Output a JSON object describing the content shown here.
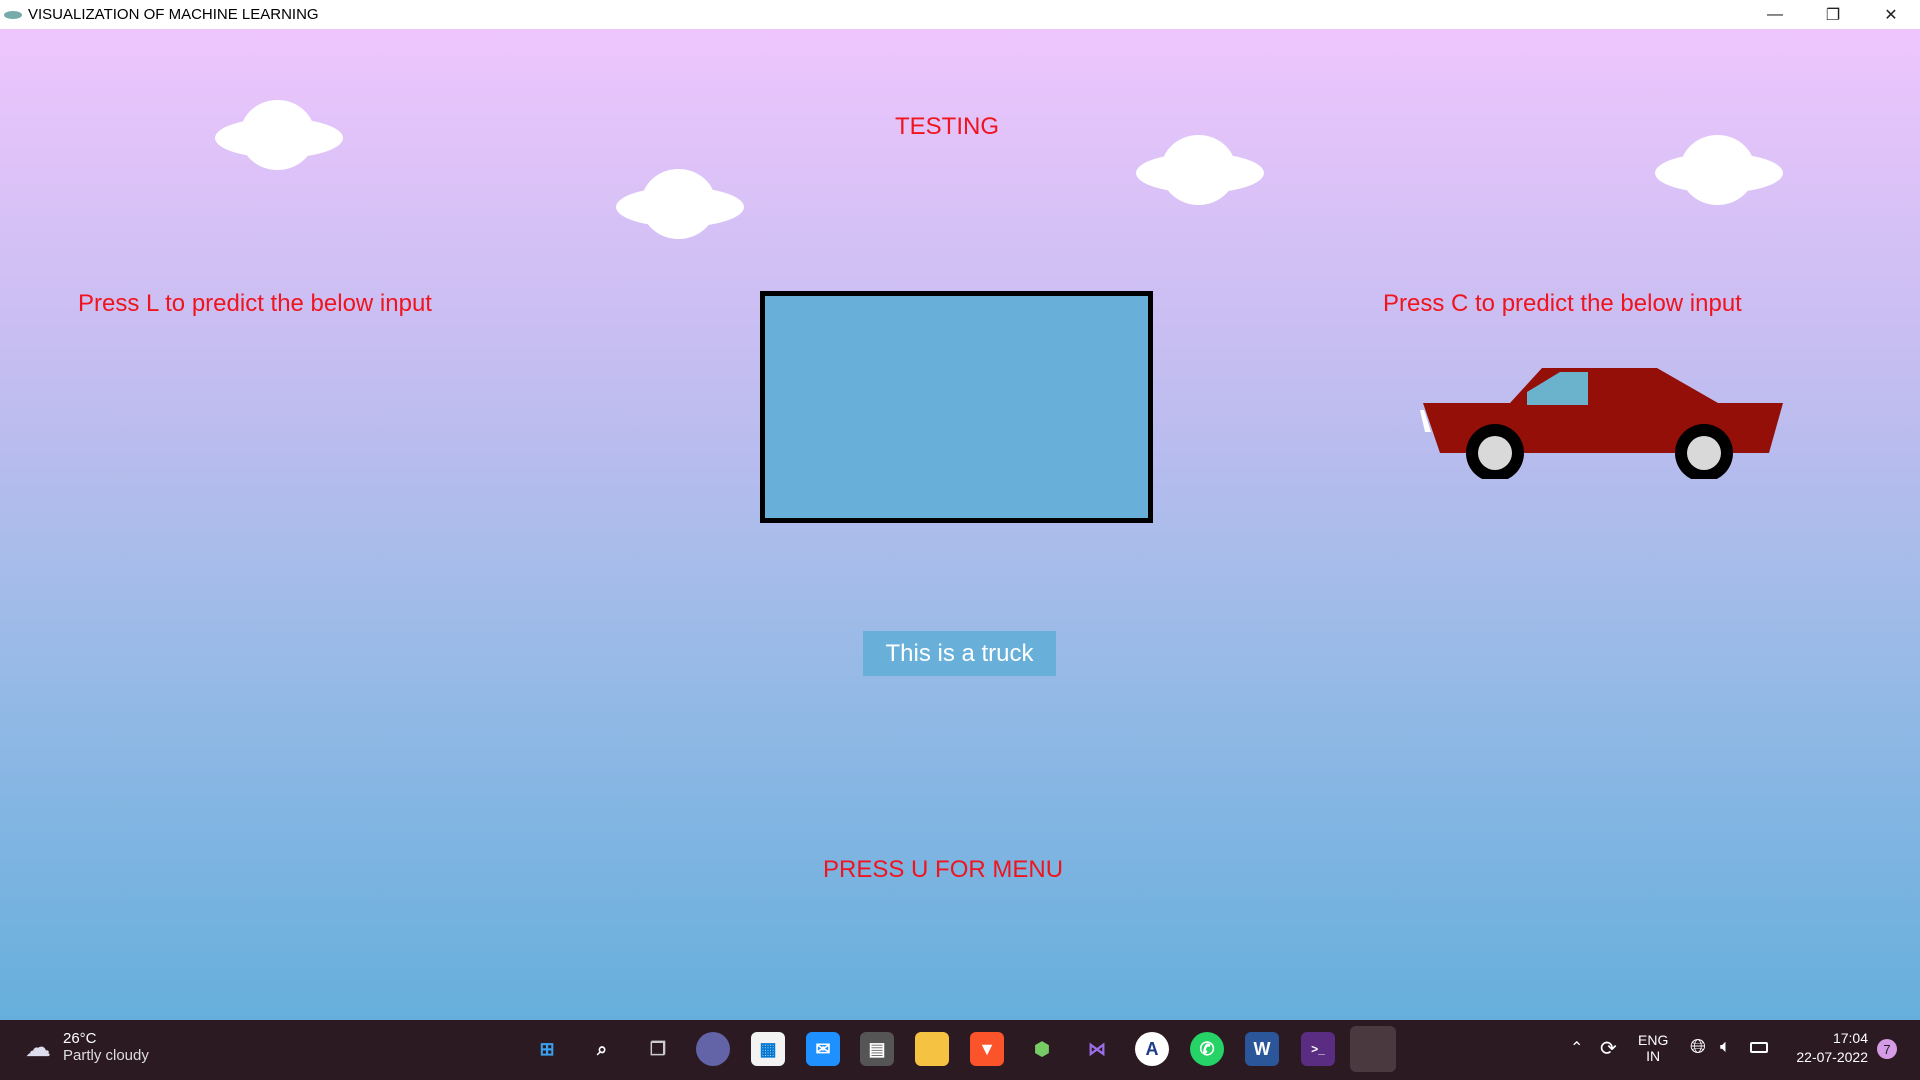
{
  "window": {
    "title": "VISUALIZATION OF MACHINE LEARNING",
    "minimize": "—",
    "restore": "❐",
    "close": "✕"
  },
  "canvas": {
    "heading": "TESTING",
    "left_instruction": "Press L to predict the below input",
    "right_instruction": "Press C to predict the below input",
    "prediction": "This is a truck",
    "menu_hint": "PRESS U FOR MENU"
  },
  "colors": {
    "text": "#f0141e",
    "car": "#930f08",
    "screen": "#68b0da"
  },
  "taskbar": {
    "weather": {
      "temp": "26°C",
      "condition": "Partly cloudy"
    },
    "apps": [
      "start",
      "search",
      "task-view",
      "teams-chat",
      "microsoft-store",
      "mail",
      "calculator",
      "file-explorer",
      "brave",
      "app-hexagon",
      "visual-studio",
      "app-circle",
      "whatsapp",
      "word",
      "terminal",
      "active-app"
    ],
    "tray": {
      "lang1": "ENG",
      "lang2": "IN",
      "time": "17:04",
      "date": "22-07-2022",
      "notifications": "7"
    }
  }
}
